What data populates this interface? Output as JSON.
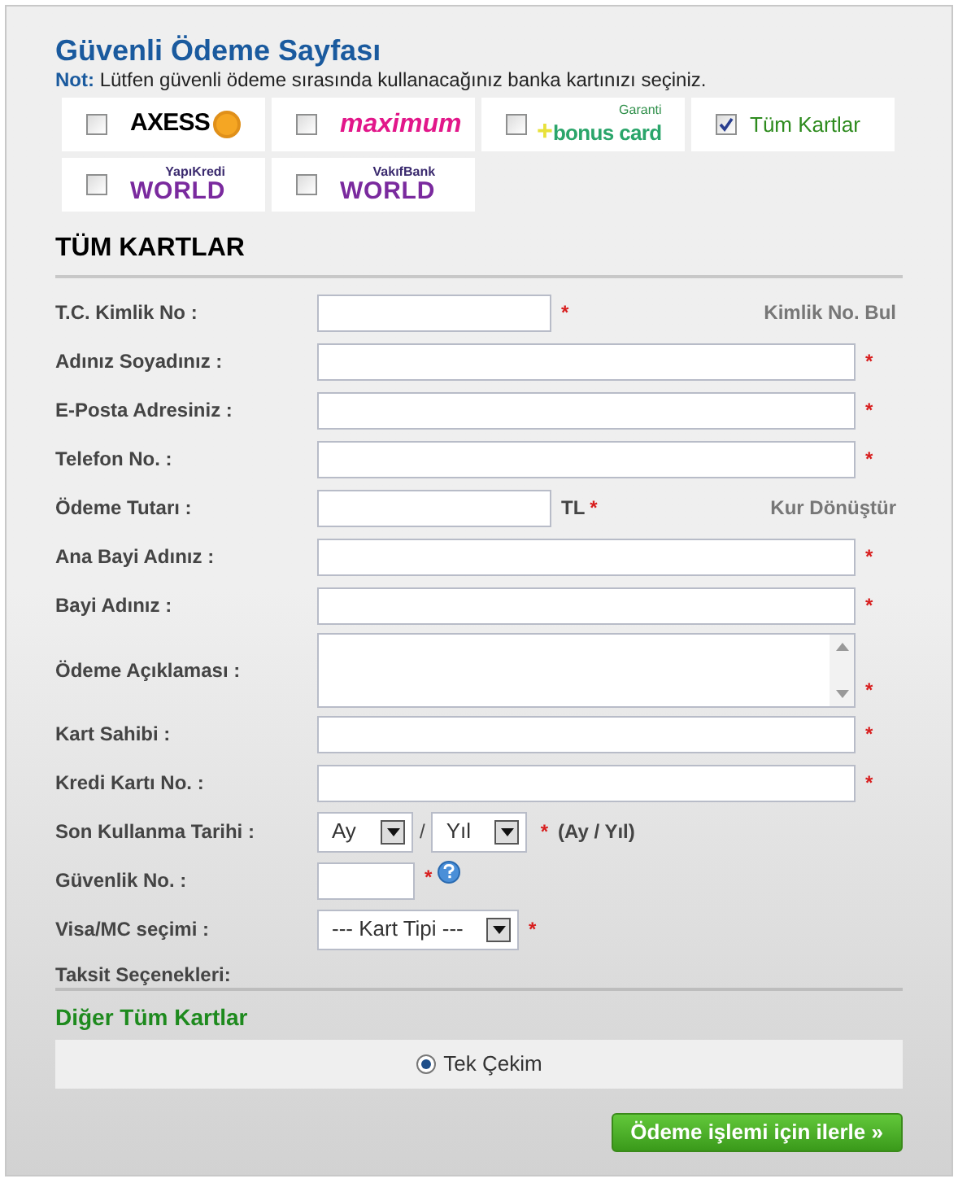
{
  "title": "Güvenli Ödeme Sayfası",
  "note": {
    "label": "Not:",
    "text": "Lütfen güvenli ödeme sırasında kullanacağınız banka kartınızı seçiniz."
  },
  "cards": [
    {
      "kind": "axess",
      "texts": [
        "AXESS"
      ],
      "checked": false
    },
    {
      "kind": "maximum",
      "texts": [
        "maximum"
      ],
      "checked": false
    },
    {
      "kind": "bonus",
      "texts": [
        "Garanti",
        "+",
        "bonus card"
      ],
      "checked": false
    },
    {
      "kind": "all",
      "texts": [
        "Tüm Kartlar"
      ],
      "checked": true
    },
    {
      "kind": "world",
      "texts": [
        "YapıKredi",
        "WORLD"
      ],
      "checked": false
    },
    {
      "kind": "world",
      "texts": [
        "VakıfBank",
        "WORLD"
      ],
      "checked": false
    }
  ],
  "section_title": "TÜM KARTLAR",
  "fields": [
    {
      "kind": "short",
      "label": "T.C. Kimlik No :",
      "mark": "*",
      "link": "Kimlik No. Bul"
    },
    {
      "kind": "text",
      "label": "Adınız Soyadınız :",
      "mark": "*"
    },
    {
      "kind": "text",
      "label": "E-Posta Adresiniz :",
      "mark": "*"
    },
    {
      "kind": "text",
      "label": "Telefon No. :",
      "mark": "*"
    },
    {
      "kind": "short",
      "label": "Ödeme Tutarı :",
      "unit": "TL",
      "mark": "*",
      "link": "Kur Dönüştür"
    },
    {
      "kind": "text",
      "label": "Ana Bayi Adınız :",
      "mark": "*"
    },
    {
      "kind": "text",
      "label": "Bayi Adınız :",
      "mark": "*"
    },
    {
      "kind": "textarea",
      "label": "Ödeme Açıklaması :",
      "mark": "*"
    },
    {
      "kind": "text",
      "label": "Kart Sahibi :",
      "mark": "*"
    },
    {
      "kind": "text",
      "label": "Kredi Kartı No. :",
      "mark": "*"
    },
    {
      "kind": "expiry",
      "label": "Son Kullanma Tarihi :",
      "month": "Ay",
      "separator": "/",
      "year": "Yıl",
      "mark": "*",
      "hint": "(Ay / Yıl)"
    },
    {
      "kind": "cvv",
      "label": "Güvenlik No. :",
      "mark": "*"
    },
    {
      "kind": "select",
      "label": "Visa/MC seçimi :",
      "value": "--- Kart Tipi ---",
      "mark": "*"
    }
  ],
  "installments": {
    "label": "Taksit Seçenekleri:",
    "group_title": "Diğer Tüm Kartlar",
    "options": [
      {
        "label": "Tek Çekim",
        "selected": true
      }
    ]
  },
  "submit": "Ödeme işlemi için ilerle »"
}
